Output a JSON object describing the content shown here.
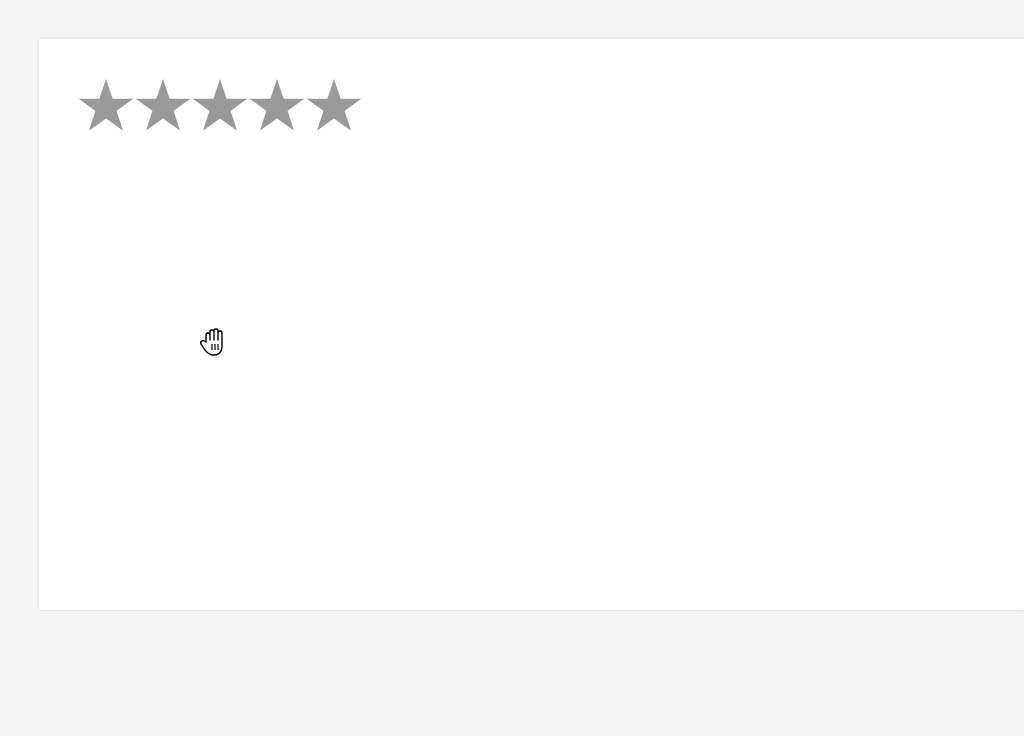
{
  "rating": {
    "max_stars": 5,
    "value": 0,
    "star_color": "#999999",
    "star_icon": "star-icon"
  },
  "cursor": {
    "icon": "grab-hand-cursor-icon"
  },
  "colors": {
    "background": "#f3f3f3",
    "card": "#ffffff"
  }
}
